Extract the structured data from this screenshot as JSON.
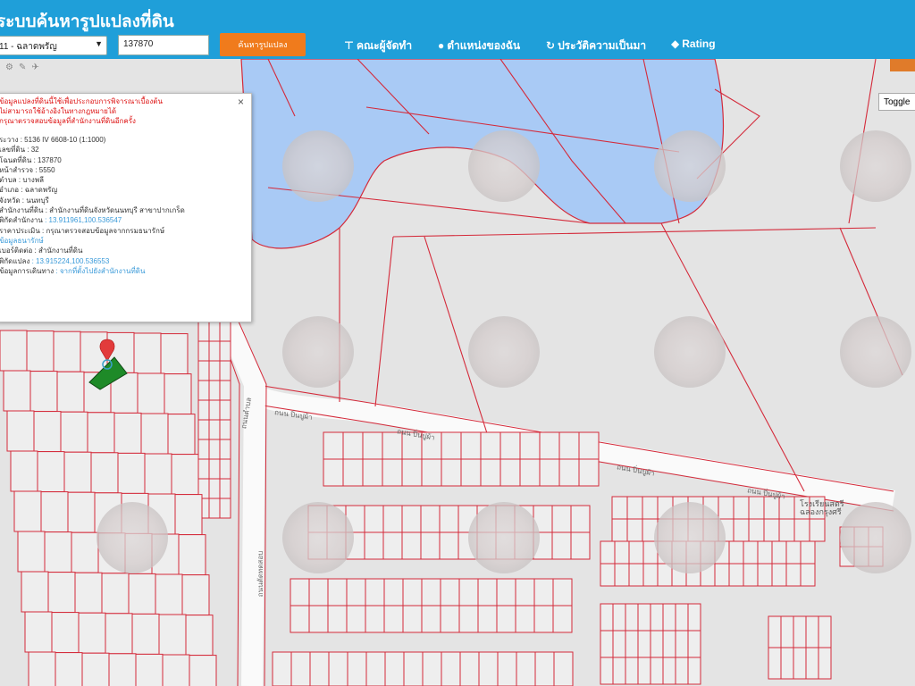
{
  "header": {
    "title": "ระบบค้นหารูปแปลงที่ดิน",
    "province_select": "11 - ฉลาดพรัญ",
    "parcel_value": "137870",
    "search_label": "ค้นหารูปแปลง",
    "nav": [
      {
        "icon": "tree-pin-icon",
        "label": "คณะผู้จัดทำ"
      },
      {
        "icon": "person-icon",
        "label": "ตำแหน่งของฉัน"
      },
      {
        "icon": "history-icon",
        "label": "ประวัติความเป็นมา"
      },
      {
        "icon": "tag-icon",
        "label": "Rating"
      }
    ]
  },
  "map": {
    "toggle_label": "Toggle",
    "landmark_label": "โรงเรียนสตรี\nฉลองกรุงศรี",
    "road_labels": [
      "ถนน ปิ่นปูผ้า",
      "ถนน ปิ่นปูผ้า",
      "ถนน ปิ่นปูผ้า",
      "ถนน ปิ่นปูผ้า",
      "ถนนตำบล",
      "ถนนตัดทดสอบ"
    ]
  },
  "popup": {
    "warning_lines": [
      "ข้อมูลแปลงที่ดินนี้ใช้เพื่อประกอบการพิจารณาเบื้องต้น",
      "ไม่สามารถใช้อ้างอิงในทางกฎหมายได้",
      "กรุณาตรวจสอบข้อมูลที่สำนักงานที่ดินอีกครั้ง"
    ],
    "rows": [
      {
        "label": "ระวาง",
        "value": ": 5136 IV 6608-10 (1:1000)"
      },
      {
        "label": "เลขที่ดิน",
        "value": ": 32"
      },
      {
        "label": "โฉนดที่ดิน",
        "value": ": 137870"
      },
      {
        "label": "หน้าสำรวจ",
        "value": ": 5550"
      },
      {
        "label": "ตำบล",
        "value": ": บางพลี"
      },
      {
        "label": "อำเภอ",
        "value": ": ฉลาดพรัญ"
      },
      {
        "label": "จังหวัด",
        "value": ": นนทบุรี"
      },
      {
        "label": "สำนักงานที่ดิน",
        "value": ": สำนักงานที่ดินจังหวัดนนทบุรี สาขาปากเกร็ด"
      },
      {
        "label": "พิกัดสำนักงาน",
        "value": ": 13.911961,100.536547",
        "link": true
      },
      {
        "label": "ราคาประเมิน",
        "value": ": กรุณาตรวจสอบข้อมูลจากกรมธนารักษ์"
      },
      {
        "label": "",
        "value": "ข้อมูลธนารักษ์",
        "link": true
      },
      {
        "label": "เบอร์ติดต่อ",
        "value": ": สำนักงานที่ดิน"
      },
      {
        "label": "พิกัดแปลง",
        "value": ": 13.915224,100.536553",
        "link": true
      },
      {
        "label": "ข้อมูลการเดินทาง",
        "value": ": จากที่ตั้งไปยังสำนักงานที่ดิน",
        "link": true
      }
    ]
  },
  "colors": {
    "header": "#1f9fd9",
    "search_button": "#f07b1c",
    "parcel_line": "#d42a3a",
    "water": "#a9caf5",
    "selected_parcel": "#1e8a28"
  }
}
